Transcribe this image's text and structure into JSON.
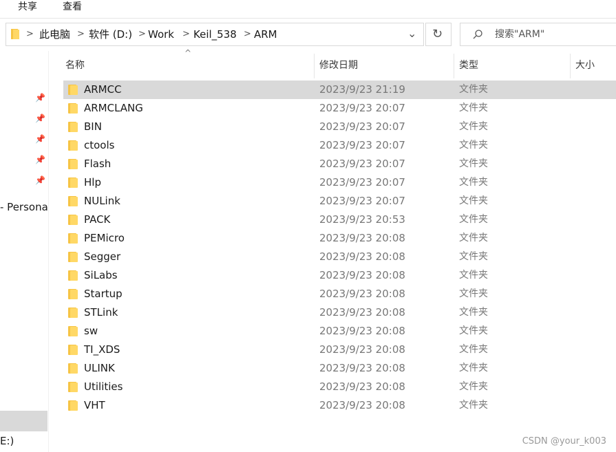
{
  "ribbon": {
    "tabs": [
      "共享",
      "查看"
    ]
  },
  "address": {
    "crumbs": [
      "此电脑",
      "软件 (D:)",
      "Work",
      "Keil_538",
      "ARM"
    ],
    "separator": ">",
    "dropdown_glyph": "⌄",
    "refresh_glyph": "↻"
  },
  "search": {
    "placeholder": "搜索\"ARM\""
  },
  "nav": {
    "partial_label": "- Persona",
    "drive_partial": "E:)",
    "pin_icon": "pin-icon"
  },
  "columns": {
    "name": "名称",
    "date": "修改日期",
    "type": "类型",
    "size": "大小",
    "sort_glyph": "^"
  },
  "files": [
    {
      "name": "ARMCC",
      "date": "2023/9/23 21:19",
      "type": "文件夹",
      "selected": true
    },
    {
      "name": "ARMCLANG",
      "date": "2023/9/23 20:07",
      "type": "文件夹"
    },
    {
      "name": "BIN",
      "date": "2023/9/23 20:07",
      "type": "文件夹"
    },
    {
      "name": "ctools",
      "date": "2023/9/23 20:07",
      "type": "文件夹"
    },
    {
      "name": "Flash",
      "date": "2023/9/23 20:07",
      "type": "文件夹"
    },
    {
      "name": "Hlp",
      "date": "2023/9/23 20:07",
      "type": "文件夹"
    },
    {
      "name": "NULink",
      "date": "2023/9/23 20:07",
      "type": "文件夹"
    },
    {
      "name": "PACK",
      "date": "2023/9/23 20:53",
      "type": "文件夹"
    },
    {
      "name": "PEMicro",
      "date": "2023/9/23 20:08",
      "type": "文件夹"
    },
    {
      "name": "Segger",
      "date": "2023/9/23 20:08",
      "type": "文件夹"
    },
    {
      "name": "SiLabs",
      "date": "2023/9/23 20:08",
      "type": "文件夹"
    },
    {
      "name": "Startup",
      "date": "2023/9/23 20:08",
      "type": "文件夹"
    },
    {
      "name": "STLink",
      "date": "2023/9/23 20:08",
      "type": "文件夹"
    },
    {
      "name": "sw",
      "date": "2023/9/23 20:08",
      "type": "文件夹"
    },
    {
      "name": "TI_XDS",
      "date": "2023/9/23 20:08",
      "type": "文件夹"
    },
    {
      "name": "ULINK",
      "date": "2023/9/23 20:08",
      "type": "文件夹"
    },
    {
      "name": "Utilities",
      "date": "2023/9/23 20:08",
      "type": "文件夹"
    },
    {
      "name": "VHT",
      "date": "2023/9/23 20:08",
      "type": "文件夹"
    }
  ],
  "watermark": "CSDN @your_k003",
  "colors": {
    "selected_row": "#d9d9d9",
    "folder": "#ffd866"
  }
}
